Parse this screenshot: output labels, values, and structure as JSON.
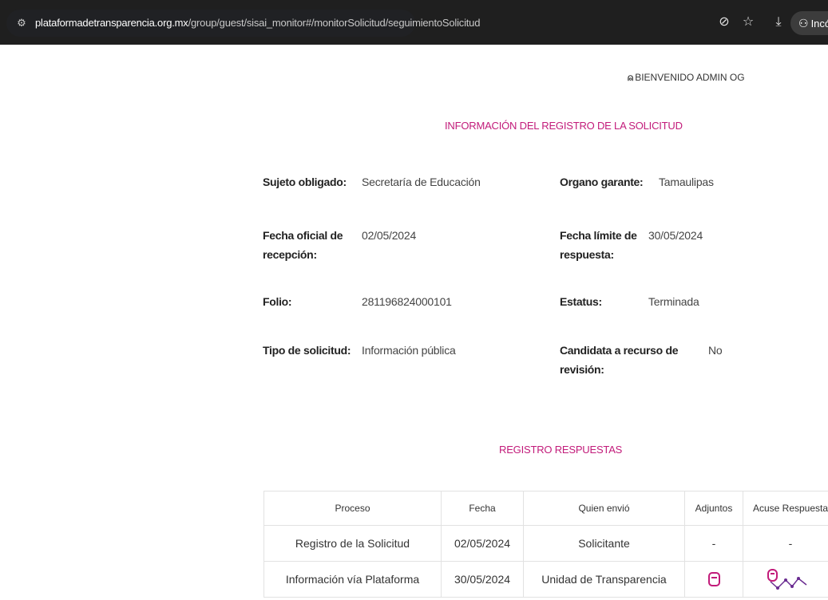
{
  "browser": {
    "url_host": "plataformadetransparencia.org.mx",
    "url_path": "/group/guest/sisai_monitor#/monitorSolicitud/seguimientoSolicitud",
    "incognito_label": "Incógnito"
  },
  "header": {
    "welcome": "BIENVENIDO ADMIN OG"
  },
  "info": {
    "title": "INFORMACIÓN DEL REGISTRO DE LA SOLICITUD",
    "sujeto_label": "Sujeto obligado:",
    "sujeto_value": "Secretaría de Educación",
    "organo_label": "Organo garante:",
    "organo_value": "Tamaulipas",
    "fecha_oficial_label": "Fecha oficial de recepción:",
    "fecha_oficial_value": "02/05/2024",
    "fecha_limite_label": "Fecha límite de respuesta:",
    "fecha_limite_value": "30/05/2024",
    "folio_label": "Folio:",
    "folio_value": "281196824000101",
    "estatus_label": "Estatus:",
    "estatus_value": "Terminada",
    "tipo_label": "Tipo de solicitud:",
    "tipo_value": "Información pública",
    "candidata_label": "Candidata a recurso de revisión:",
    "candidata_value": "No"
  },
  "respuestas": {
    "title": "REGISTRO RESPUESTAS",
    "columns": [
      "Proceso",
      "Fecha",
      "Quien envió",
      "Adjuntos",
      "Acuse Respuesta"
    ],
    "rows": [
      {
        "proceso": "Registro de la Solicitud",
        "fecha": "02/05/2024",
        "quien": "Solicitante",
        "adjuntos": "-",
        "acuse": "-"
      },
      {
        "proceso": "Información vía Plataforma",
        "fecha": "30/05/2024",
        "quien": "Unidad de Transparencia",
        "adjuntos_icon": "document-icon",
        "acuse_icon": "acuse-icon"
      }
    ]
  },
  "colors": {
    "accent": "#c21b7a",
    "browser_bar": "#1f1f1f"
  }
}
